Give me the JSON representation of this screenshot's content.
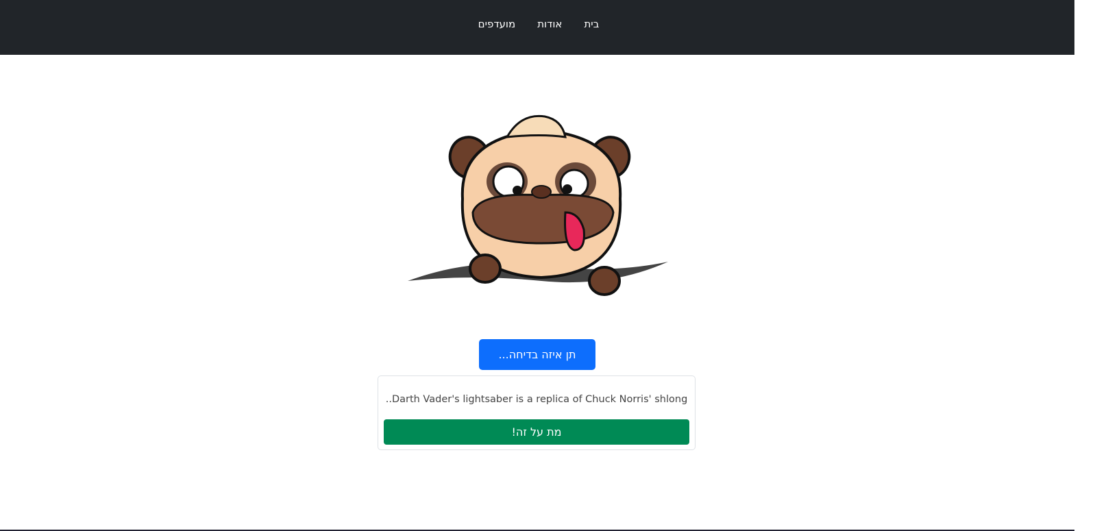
{
  "nav": {
    "items": [
      {
        "label": "בית"
      },
      {
        "label": "אודות"
      },
      {
        "label": "מועדפים"
      }
    ]
  },
  "hero": {
    "image": "pug-cartoon"
  },
  "joke_button": {
    "label": "תן איזה בדיחה..."
  },
  "joke_card": {
    "text": "Darth Vader's lightsaber is a replica of Chuck Norris' shlong..",
    "like_button": "מת על זה!"
  },
  "colors": {
    "navbar": "#212529",
    "primary": "#0d6efd",
    "success": "#008a55"
  }
}
